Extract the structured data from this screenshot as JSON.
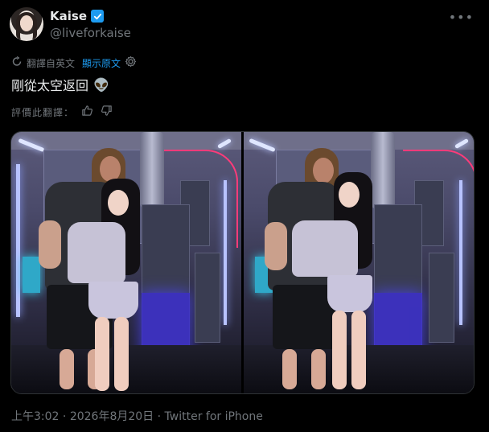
{
  "author": {
    "name": "Kaise",
    "handle": "@liveforkaise",
    "verified": true,
    "avatar_icon": "avatar"
  },
  "menu_icon": "more-horizontal-icon",
  "translation": {
    "translated_from": "翻譯自英文",
    "show_original": "顯示原文"
  },
  "tweet": {
    "text": "剛從太空返回",
    "emoji": "👽"
  },
  "rate_translation": {
    "label": "評價此翻譯："
  },
  "media": {
    "count": 2
  },
  "meta": {
    "time": "上午3:02",
    "separator1": "·",
    "date": "2026年8月20日",
    "separator2": "·",
    "client": "Twitter for iPhone"
  },
  "colors": {
    "background": "#000000",
    "text_primary": "#e7e9ea",
    "text_secondary": "#71767b",
    "accent": "#1d9bf0"
  }
}
